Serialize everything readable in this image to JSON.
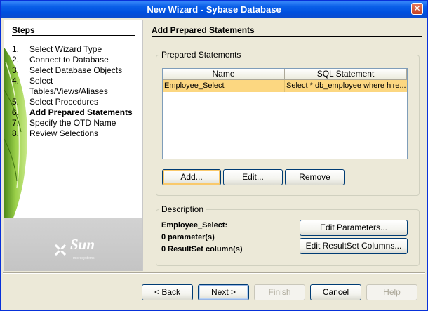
{
  "window": {
    "title": "New Wizard - Sybase Database",
    "close_glyph": "✕"
  },
  "steps": {
    "title": "Steps",
    "items": [
      {
        "num": "1.",
        "label": "Select Wizard Type"
      },
      {
        "num": "2.",
        "label": "Connect to Database"
      },
      {
        "num": "3.",
        "label": "Select Database Objects"
      },
      {
        "num": "4.",
        "label": "Select Tables/Views/Aliases"
      },
      {
        "num": "5.",
        "label": "Select Procedures"
      },
      {
        "num": "6.",
        "label": "Add Prepared Statements",
        "active": true
      },
      {
        "num": "7.",
        "label": "Specify the OTD Name"
      },
      {
        "num": "8.",
        "label": "Review Selections"
      }
    ]
  },
  "branding": {
    "logo": "Sun",
    "tagline": "microsystems",
    "logo_icon": "sun-microsystems-logo-icon"
  },
  "page": {
    "title": "Add Prepared Statements"
  },
  "prepared": {
    "legend": "Prepared Statements",
    "columns": [
      "Name",
      "SQL Statement"
    ],
    "rows": [
      {
        "name": "Employee_Select",
        "sql": "Select * db_employee where hire..."
      }
    ],
    "selected_color": "#fcd781",
    "buttons": {
      "add": "Add...",
      "edit": "Edit...",
      "remove": "Remove"
    }
  },
  "description": {
    "legend": "Description",
    "name": "Employee_Select:",
    "params": "0 parameter(s)",
    "columns": "0 ResultSet column(s)",
    "buttons": {
      "edit_params": "Edit Parameters...",
      "edit_resultset": "Edit ResultSet Columns..."
    }
  },
  "footer": {
    "back_pre": "< ",
    "back_accel": "B",
    "back_post": "ack",
    "next": "Next >",
    "finish_accel": "F",
    "finish_post": "inish",
    "cancel": "Cancel",
    "help_accel": "H",
    "help_post": "elp"
  },
  "colors": {
    "title_bar": "#0a5fe8",
    "dialog_bg": "#ece9d8",
    "selection": "#fcd781"
  }
}
